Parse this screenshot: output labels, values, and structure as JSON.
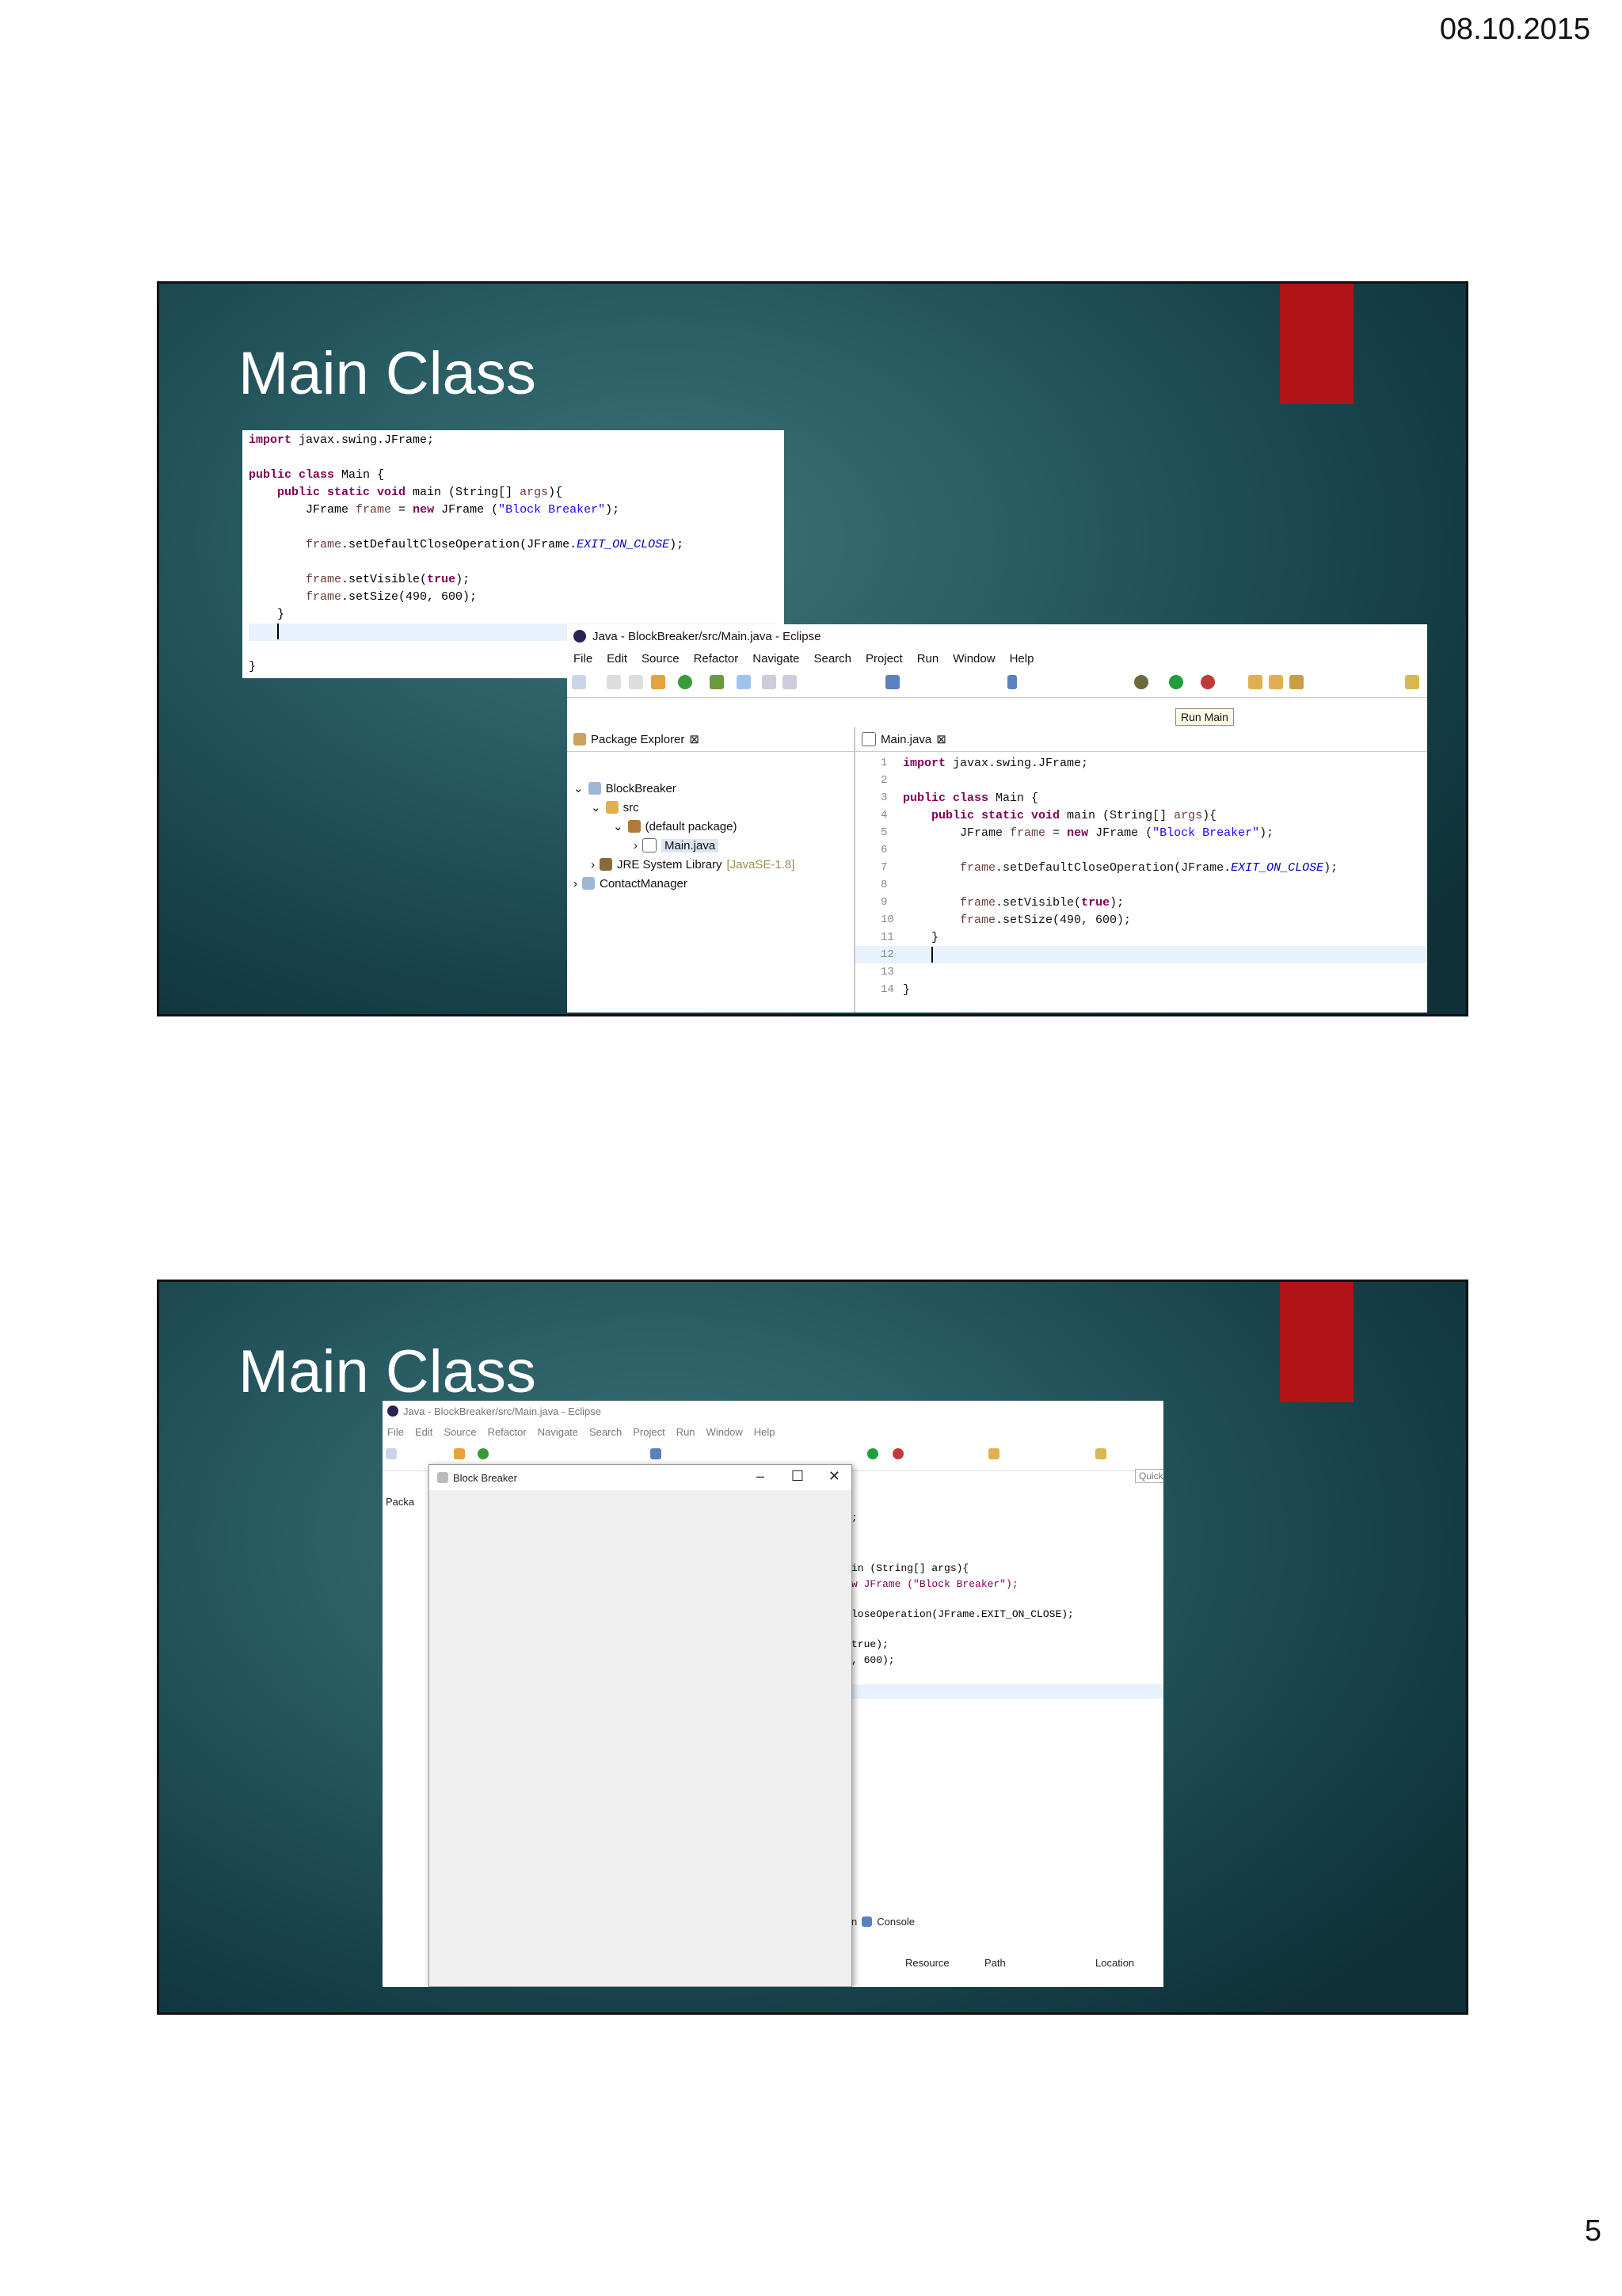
{
  "header": {
    "date": "08.10.2015"
  },
  "footer": {
    "page_number": "5"
  },
  "slide1": {
    "title": "Main Class",
    "code_lines": [
      "import javax.swing.JFrame;",
      "",
      "public class Main {",
      "    public static void main (String[] args){",
      "        JFrame frame = new JFrame (\"Block Breaker\");",
      "",
      "        frame.setDefaultCloseOperation(JFrame.EXIT_ON_CLOSE);",
      "",
      "        frame.setVisible(true);",
      "        frame.setSize(490, 600);",
      "    }",
      "",
      "",
      "}"
    ],
    "eclipse": {
      "window_title": "Java - BlockBreaker/src/Main.java - Eclipse",
      "menu": [
        "File",
        "Edit",
        "Source",
        "Refactor",
        "Navigate",
        "Search",
        "Project",
        "Run",
        "Window",
        "Help"
      ],
      "tooltip": "Run Main",
      "package_explorer_tab": "Package Explorer",
      "tree": [
        {
          "label": "BlockBreaker",
          "depth": 0
        },
        {
          "label": "src",
          "depth": 1
        },
        {
          "label": "(default package)",
          "depth": 2
        },
        {
          "label": "Main.java",
          "depth": 3
        },
        {
          "label": "JRE System Library",
          "suffix": "[JavaSE-1.8]",
          "depth": 1
        },
        {
          "label": "ContactManager",
          "depth": 0
        }
      ],
      "editor_tab": "Main.java",
      "line_numbers": [
        "1",
        "2",
        "3",
        "4",
        "5",
        "6",
        "7",
        "8",
        "9",
        "10",
        "11",
        "12",
        "13",
        "14"
      ]
    }
  },
  "slide2": {
    "title": "Main Class",
    "eclipse": {
      "window_title": "Java - BlockBreaker/src/Main.java - Eclipse",
      "menu": [
        "File",
        "Edit",
        "Source",
        "Refactor",
        "Navigate",
        "Search",
        "Project",
        "Run",
        "Window",
        "Help"
      ],
      "package_tab": "Packa",
      "quick_access": "Quick",
      "code_fragments": [
        ";",
        "in (String[] args){",
        "w JFrame (\"Block Breaker\");",
        "loseOperation(JFrame.EXIT_ON_CLOSE);",
        "true);",
        ", 600);"
      ],
      "console_tab": "Console",
      "console_tab_prefix": "n",
      "columns": [
        "Resource",
        "Path",
        "Location"
      ]
    },
    "window": {
      "title": "Block Breaker",
      "minimize": "–",
      "maximize": "☐",
      "close": "✕"
    }
  }
}
